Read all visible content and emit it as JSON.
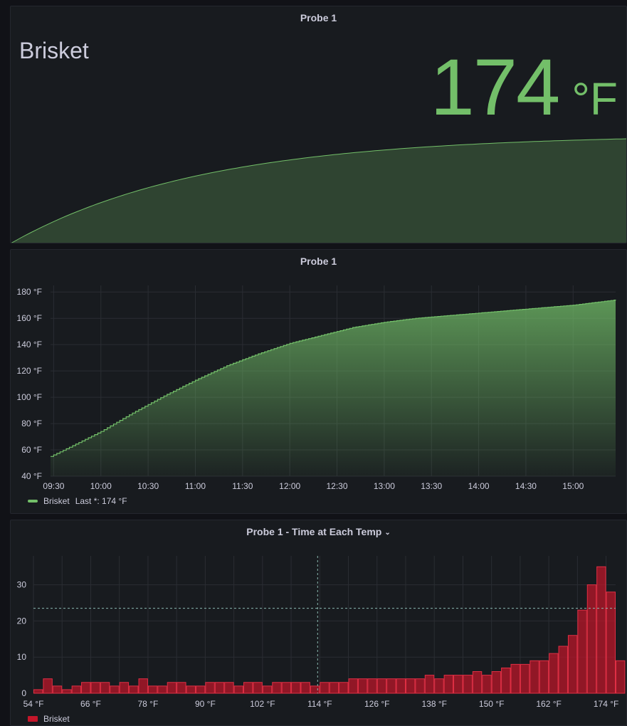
{
  "colors": {
    "green": "#73bf69",
    "red": "#c4162a",
    "grid": "#2a2d33",
    "text": "#ccccdc"
  },
  "stat_panel": {
    "title": "Probe 1",
    "series_name": "Brisket",
    "value": "174",
    "unit": "°F"
  },
  "timeseries_panel": {
    "title": "Probe 1",
    "legend": {
      "name": "Brisket",
      "stat": "Last *: 174 °F"
    }
  },
  "histogram_panel": {
    "title": "Probe 1 - Time at Each Temp",
    "chevron": "chevron-down-icon",
    "legend": {
      "name": "Brisket"
    }
  },
  "chart_data": [
    {
      "type": "area",
      "title": "Probe 1",
      "series": [
        {
          "name": "Brisket",
          "x_range": [
            "09:27",
            "15:27"
          ],
          "y_start": 55,
          "y_end": 174
        }
      ]
    },
    {
      "type": "area",
      "title": "Probe 1",
      "ylim": [
        40,
        185
      ],
      "y_ticks": [
        40,
        60,
        80,
        100,
        120,
        140,
        160,
        180
      ],
      "y_tick_labels": [
        "40 °F",
        "60 °F",
        "80 °F",
        "100 °F",
        "120 °F",
        "140 °F",
        "160 °F",
        "180 °F"
      ],
      "x_tick_labels": [
        "09:30",
        "10:00",
        "10:30",
        "11:00",
        "11:30",
        "12:00",
        "12:30",
        "13:00",
        "13:30",
        "14:00",
        "14:30",
        "15:00"
      ],
      "x_range_minutes": [
        568,
        927
      ],
      "series": [
        {
          "name": "Brisket",
          "points": [
            [
              568,
              55
            ],
            [
              580,
              62
            ],
            [
              600,
              74
            ],
            [
              620,
              88
            ],
            [
              640,
              101
            ],
            [
              660,
              113
            ],
            [
              680,
              124
            ],
            [
              700,
              133
            ],
            [
              720,
              141
            ],
            [
              740,
              147
            ],
            [
              760,
              153
            ],
            [
              780,
              157
            ],
            [
              800,
              160
            ],
            [
              820,
              162
            ],
            [
              840,
              164
            ],
            [
              860,
              166
            ],
            [
              880,
              168
            ],
            [
              900,
              170
            ],
            [
              927,
              174
            ]
          ]
        }
      ]
    },
    {
      "type": "bar",
      "title": "Probe 1 - Time at Each Temp",
      "x_tick_labels": [
        "54 °F",
        "66 °F",
        "78 °F",
        "90 °F",
        "102 °F",
        "114 °F",
        "126 °F",
        "138 °F",
        "150 °F",
        "162 °F",
        "174 °F"
      ],
      "x_range": [
        54,
        176
      ],
      "bin_width": 2,
      "bin_starts": [
        54,
        56,
        58,
        60,
        62,
        64,
        66,
        68,
        70,
        72,
        74,
        76,
        78,
        80,
        82,
        84,
        86,
        88,
        90,
        92,
        94,
        96,
        98,
        100,
        102,
        104,
        106,
        108,
        110,
        112,
        114,
        116,
        118,
        120,
        122,
        124,
        126,
        128,
        130,
        132,
        134,
        136,
        138,
        140,
        142,
        144,
        146,
        148,
        150,
        152,
        154,
        156,
        158,
        160,
        162,
        164,
        166,
        168,
        170,
        172,
        174
      ],
      "values": [
        1,
        4,
        2,
        1,
        2,
        3,
        3,
        3,
        2,
        3,
        2,
        4,
        2,
        2,
        3,
        3,
        2,
        2,
        3,
        3,
        3,
        2,
        3,
        3,
        2,
        3,
        3,
        3,
        3,
        2,
        3,
        3,
        3,
        4,
        4,
        4,
        4,
        4,
        4,
        4,
        4,
        5,
        4,
        5,
        5,
        5,
        6,
        5,
        6,
        7,
        8,
        8,
        9,
        9,
        11,
        13,
        16,
        23,
        30,
        35,
        28,
        9
      ],
      "ylim": [
        0,
        38
      ],
      "y_ticks": [
        0,
        10,
        20,
        30
      ],
      "series": [
        {
          "name": "Brisket"
        }
      ]
    }
  ]
}
